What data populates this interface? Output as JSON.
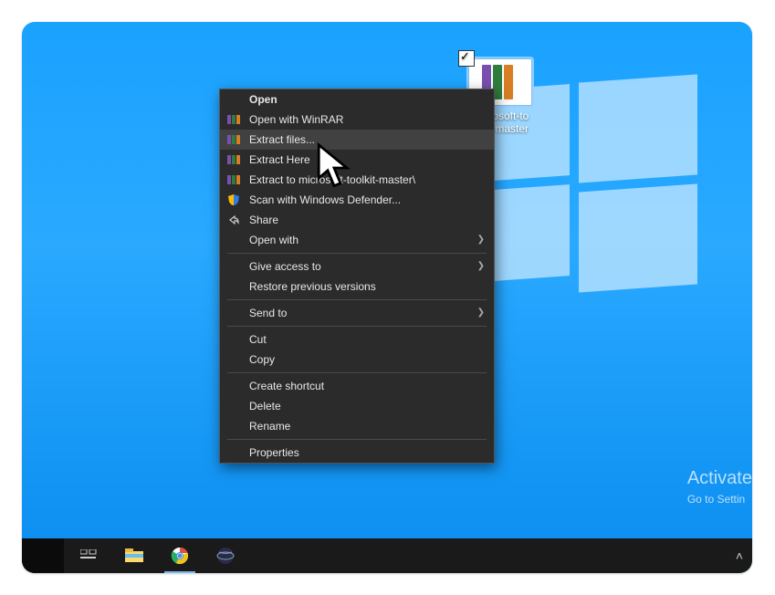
{
  "desktop_icon": {
    "label_line1": "microsoft-to",
    "label_line2": "olkit-master",
    "books_colors": [
      "#7a4fb0",
      "#2f7d3d",
      "#d87e24"
    ]
  },
  "context_menu": {
    "open": "Open",
    "open_winrar": "Open with WinRAR",
    "extract_files": "Extract files...",
    "extract_here": "Extract Here",
    "extract_to": "Extract to microsoft-toolkit-master\\",
    "scan_defender": "Scan with Windows Defender...",
    "share": "Share",
    "open_with": "Open with",
    "give_access": "Give access to",
    "restore_prev": "Restore previous versions",
    "send_to": "Send to",
    "cut": "Cut",
    "copy": "Copy",
    "create_shortcut": "Create shortcut",
    "delete": "Delete",
    "rename": "Rename",
    "properties": "Properties"
  },
  "activation": {
    "title": "Activate",
    "subtitle": "Go to Settin"
  }
}
